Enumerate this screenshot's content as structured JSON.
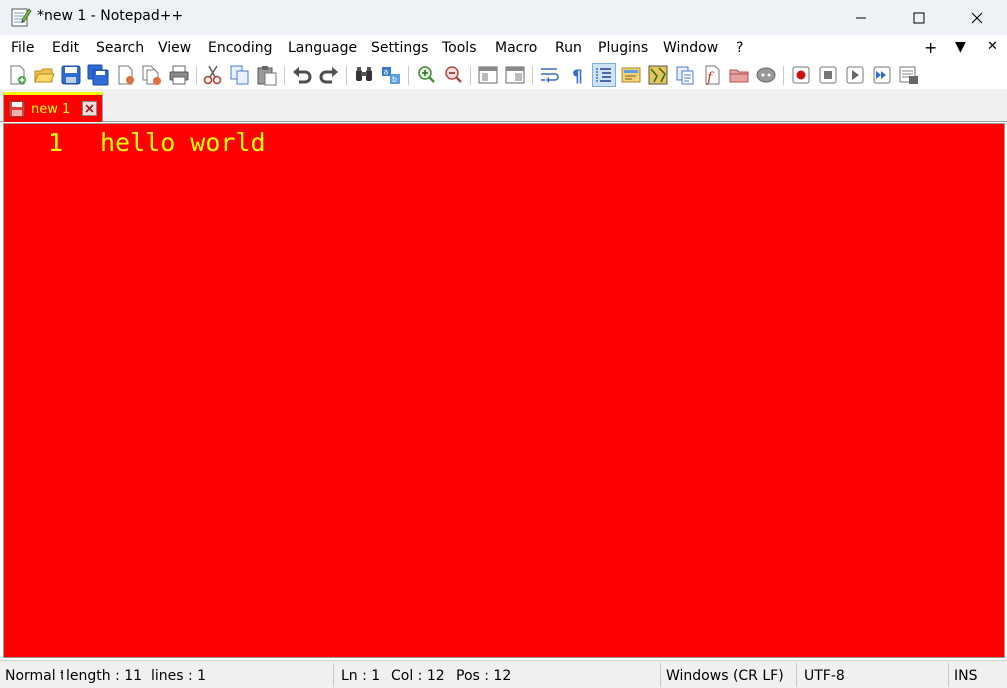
{
  "window": {
    "title": "*new 1 - Notepad++"
  },
  "menu": {
    "items": [
      "File",
      "Edit",
      "Search",
      "View",
      "Encoding",
      "Language",
      "Settings",
      "Tools",
      "Macro",
      "Run",
      "Plugins",
      "Window",
      "?"
    ],
    "right_items": [
      "+",
      "▼",
      "✕"
    ]
  },
  "toolbar": {
    "icons": [
      "new-file-icon",
      "open-file-icon",
      "save-icon",
      "save-all-icon",
      "close-icon",
      "close-all-icon",
      "print-icon",
      "cut-icon",
      "copy-icon",
      "paste-icon",
      "undo-icon",
      "redo-icon",
      "find-icon",
      "replace-icon",
      "zoom-in-icon",
      "zoom-out-icon",
      "sync-vertical-icon",
      "sync-horizontal-icon",
      "word-wrap-icon",
      "show-all-chars-icon",
      "indent-guide-icon",
      "udl-icon",
      "doc-map-icon",
      "doc-list-icon",
      "function-list-icon",
      "folder-workspace-icon",
      "monitoring-icon",
      "macro-record-icon",
      "macro-stop-icon",
      "macro-play-icon",
      "macro-run-multiple-icon",
      "macro-save-icon"
    ]
  },
  "tabs": [
    {
      "label": "new 1",
      "modified": true
    }
  ],
  "editor": {
    "lines": [
      {
        "number": "1",
        "text": "hello world"
      }
    ],
    "background": "#ff0000",
    "foreground": "#ffff00"
  },
  "status": {
    "type": "Normal t",
    "length": "length : 11",
    "lines": "lines : 1",
    "ln": "Ln : 1",
    "col": "Col : 12",
    "pos": "Pos : 12",
    "eol": "Windows (CR LF)",
    "encoding": "UTF-8",
    "mode": "INS"
  },
  "colors": {
    "editor_bg": "#ff0000",
    "editor_fg": "#ffff00",
    "tab_indicator": "#ffff00",
    "titlebar_bg": "#eef2f7"
  }
}
